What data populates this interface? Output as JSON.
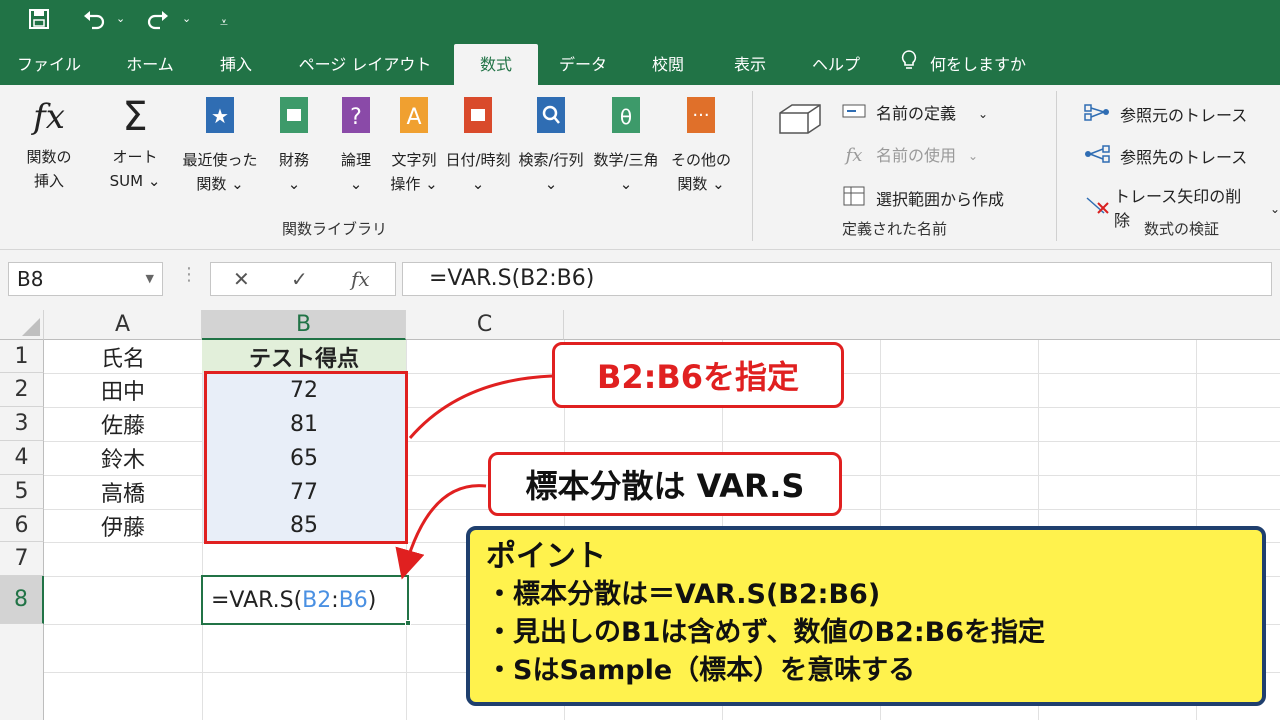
{
  "quick_access": {
    "save_icon": "save-icon",
    "undo_icon": "undo-icon",
    "redo_icon": "redo-icon",
    "customize_icon": "customize-icon"
  },
  "tabs": [
    "ファイル",
    "ホーム",
    "挿入",
    "ページ レイアウト",
    "数式",
    "データ",
    "校閲",
    "表示",
    "ヘルプ"
  ],
  "active_tab": "数式",
  "tell_me": "何をしますか",
  "ribbon": {
    "insert_function": "関数の\n挿入",
    "autosum": "オート\nSUM ⌄",
    "recent": "最近使った\n関数 ⌄",
    "financial": "財務\n⌄",
    "logical": "論理\n⌄",
    "text": "文字列\n操作 ⌄",
    "datetime": "日付/時刻\n⌄",
    "lookup": "検索/行列\n⌄",
    "math": "数学/三角\n⌄",
    "more": "その他の\n関数 ⌄",
    "group_library": "関数ライブラリ",
    "define_name": "名前の定義",
    "use_in_formula": "名前の使用",
    "create_from_selection": "選択範囲から作成",
    "group_names": "定義された名前",
    "trace_precedents": "参照元のトレース",
    "trace_dependents": "参照先のトレース",
    "remove_arrows": "トレース矢印の削除",
    "group_auditing": "数式の検証"
  },
  "formula_bar": {
    "name_box": "B8",
    "cancel": "✕",
    "enter": "✓",
    "fx": "fx",
    "formula": "=VAR.S(B2:B6)"
  },
  "sheet": {
    "columns": [
      "A",
      "B",
      "C"
    ],
    "rows": [
      "1",
      "2",
      "3",
      "4",
      "5",
      "6",
      "7",
      "8"
    ],
    "header_a": "氏名",
    "header_b": "テスト得点",
    "names": [
      "田中",
      "佐藤",
      "鈴木",
      "高橋",
      "伊藤"
    ],
    "scores": [
      "72",
      "81",
      "65",
      "77",
      "85"
    ],
    "formula_cell": {
      "prefix": "=VAR.S(",
      "ref1": "B2",
      "colon": ":",
      "ref2": "B6",
      "suffix": ")"
    }
  },
  "callouts": {
    "range": "B2:B6を指定",
    "function": "標本分散は VAR.S"
  },
  "point_box": {
    "title": "ポイント",
    "items": [
      "・標本分散は＝VAR.S(B2:B6)",
      "・見出しのB1は含めず、数値のB2:B6を指定",
      "・SはSample（標本）を意味する"
    ]
  },
  "colors": {
    "excel_green": "#217346",
    "callout_red": "#e02020",
    "point_yellow": "#fff24d",
    "point_border": "#1f3f6e",
    "ref_blue": "#4a90e2",
    "range_fill": "#e8eef8"
  }
}
